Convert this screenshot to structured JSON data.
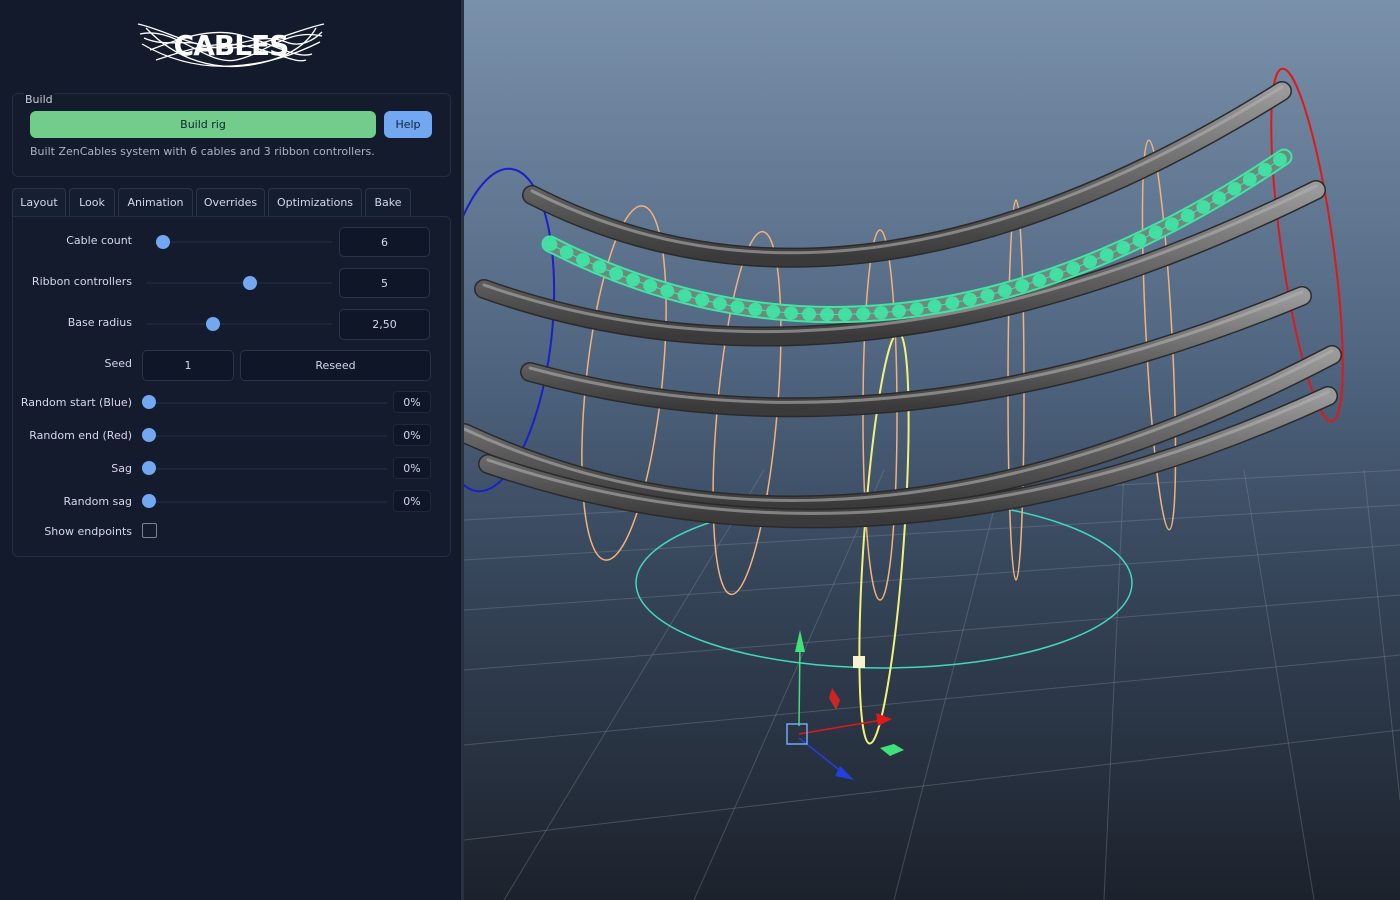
{
  "logo": {
    "text": "CABLES"
  },
  "build": {
    "legend": "Build",
    "build_button": "Build rig",
    "help_button": "Help",
    "status": "Built ZenCables system with 6 cables and 3 ribbon controllers."
  },
  "tabs": [
    "Layout",
    "Look",
    "Animation",
    "Overrides",
    "Optimizations",
    "Bake"
  ],
  "layout": {
    "cable_count": {
      "label": "Cable count",
      "value": "6",
      "level": 0.0
    },
    "ribbon_controllers": {
      "label": "Ribbon controllers",
      "value": "5",
      "level": 0.55
    },
    "base_radius": {
      "label": "Base radius",
      "value": "2,50",
      "level": 0.35
    },
    "seed": {
      "label": "Seed",
      "value": "1",
      "reseed_button": "Reseed"
    },
    "random_start": {
      "label": "Random start (Blue)",
      "value": "0%",
      "level": 0.0
    },
    "random_end": {
      "label": "Random end (Red)",
      "value": "0%",
      "level": 0.0
    },
    "sag": {
      "label": "Sag",
      "value": "0%",
      "level": 0.0
    },
    "random_sag": {
      "label": "Random sag",
      "value": "0%",
      "level": 0.0
    },
    "show_endpoints": {
      "label": "Show endpoints",
      "checked": false
    }
  },
  "colors": {
    "build_button": "#73cd8a",
    "help_button": "#72a7f1",
    "slider_handle": "#72a7f1",
    "cable": "#6b6b6b",
    "selected_cable": "#3fe6a6",
    "start_ring": "#1a1fcc",
    "end_ring": "#e01818",
    "mid_ring": "#f2b27a",
    "selected_ring": "#f2f27a",
    "base_circle": "#43d6c2"
  }
}
